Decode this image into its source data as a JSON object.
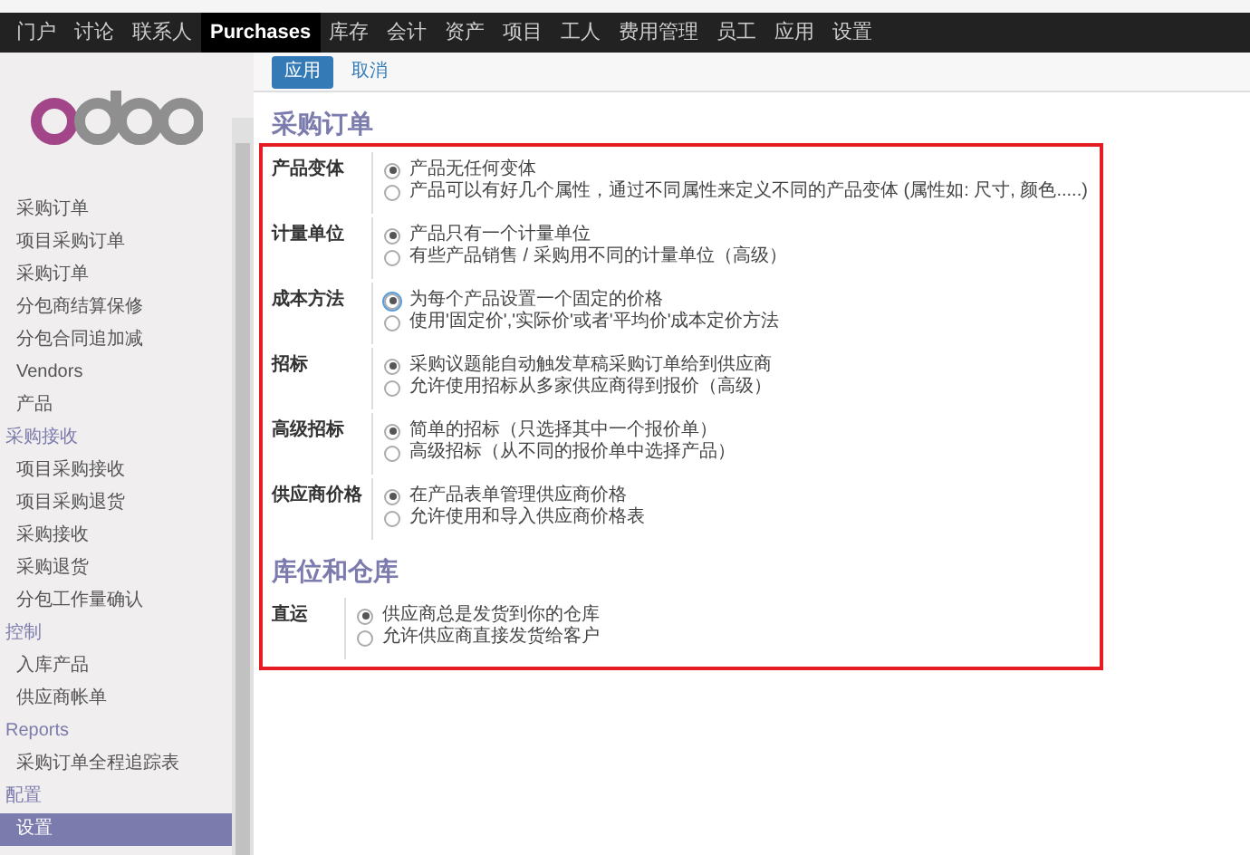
{
  "nav": [
    {
      "label": "门户",
      "selected": false
    },
    {
      "label": "讨论",
      "selected": false
    },
    {
      "label": "联系人",
      "selected": false
    },
    {
      "label": "Purchases",
      "selected": true
    },
    {
      "label": "库存",
      "selected": false
    },
    {
      "label": "会计",
      "selected": false
    },
    {
      "label": "资产",
      "selected": false
    },
    {
      "label": "项目",
      "selected": false
    },
    {
      "label": "工人",
      "selected": false
    },
    {
      "label": "费用管理",
      "selected": false
    },
    {
      "label": "员工",
      "selected": false
    },
    {
      "label": "应用",
      "selected": false
    },
    {
      "label": "设置",
      "selected": false
    }
  ],
  "sidebar": {
    "items": [
      {
        "kind": "item",
        "label": "采购订单",
        "selected": false
      },
      {
        "kind": "item",
        "label": "项目采购订单",
        "selected": false
      },
      {
        "kind": "item",
        "label": "采购订单",
        "selected": false
      },
      {
        "kind": "item",
        "label": "分包商结算保修",
        "selected": false
      },
      {
        "kind": "item",
        "label": "分包合同追加减",
        "selected": false
      },
      {
        "kind": "item",
        "label": "Vendors",
        "selected": false
      },
      {
        "kind": "item",
        "label": "产品",
        "selected": false
      },
      {
        "kind": "heading",
        "label": "采购接收"
      },
      {
        "kind": "item",
        "label": "项目采购接收",
        "selected": false
      },
      {
        "kind": "item",
        "label": "项目采购退货",
        "selected": false
      },
      {
        "kind": "item",
        "label": "采购接收",
        "selected": false
      },
      {
        "kind": "item",
        "label": "采购退货",
        "selected": false
      },
      {
        "kind": "item",
        "label": "分包工作量确认",
        "selected": false
      },
      {
        "kind": "heading",
        "label": "控制"
      },
      {
        "kind": "item",
        "label": "入库产品",
        "selected": false
      },
      {
        "kind": "item",
        "label": "供应商帐单",
        "selected": false
      },
      {
        "kind": "heading",
        "label": "Reports"
      },
      {
        "kind": "item",
        "label": "采购订单全程追踪表",
        "selected": false
      },
      {
        "kind": "heading",
        "label": "配置"
      },
      {
        "kind": "item",
        "label": "设置",
        "selected": true
      }
    ]
  },
  "buttons": [
    {
      "label": "应用",
      "kind": "primary"
    },
    {
      "label": "取消",
      "kind": "link"
    }
  ],
  "sections": [
    {
      "title": "采购订单",
      "settings": [
        {
          "label": "产品变体",
          "options": [
            {
              "text": "产品无任何变体",
              "selected": true
            },
            {
              "text": "产品可以有好几个属性，通过不同属性来定义不同的产品变体 (属性如: 尺寸, 颜色.....)",
              "selected": false
            }
          ]
        },
        {
          "label": "计量单位",
          "options": [
            {
              "text": "产品只有一个计量单位",
              "selected": true
            },
            {
              "text": "有些产品销售 / 采购用不同的计量单位（高级）",
              "selected": false
            }
          ]
        },
        {
          "label": "成本方法",
          "options": [
            {
              "text": "为每个产品设置一个固定的价格",
              "selected": true,
              "focused": true
            },
            {
              "text": "使用'固定价','实际价'或者'平均价'成本定价方法",
              "selected": false
            }
          ]
        },
        {
          "label": "招标",
          "options": [
            {
              "text": "采购议题能自动触发草稿采购订单给到供应商",
              "selected": true
            },
            {
              "text": "允许使用招标从多家供应商得到报价（高级）",
              "selected": false
            }
          ]
        },
        {
          "label": "高级招标",
          "options": [
            {
              "text": "简单的招标（只选择其中一个报价单）",
              "selected": true
            },
            {
              "text": "高级招标（从不同的报价单中选择产品）",
              "selected": false
            }
          ]
        },
        {
          "label": "供应商价格",
          "options": [
            {
              "text": "在产品表单管理供应商价格",
              "selected": true
            },
            {
              "text": "允许使用和导入供应商价格表",
              "selected": false
            }
          ]
        }
      ]
    },
    {
      "title": "库位和仓库",
      "settings": [
        {
          "label": "直运",
          "options": [
            {
              "text": "供应商总是发货到你的仓库",
              "selected": true
            },
            {
              "text": "允许供应商直接发货给客户",
              "selected": false
            }
          ]
        }
      ]
    }
  ]
}
